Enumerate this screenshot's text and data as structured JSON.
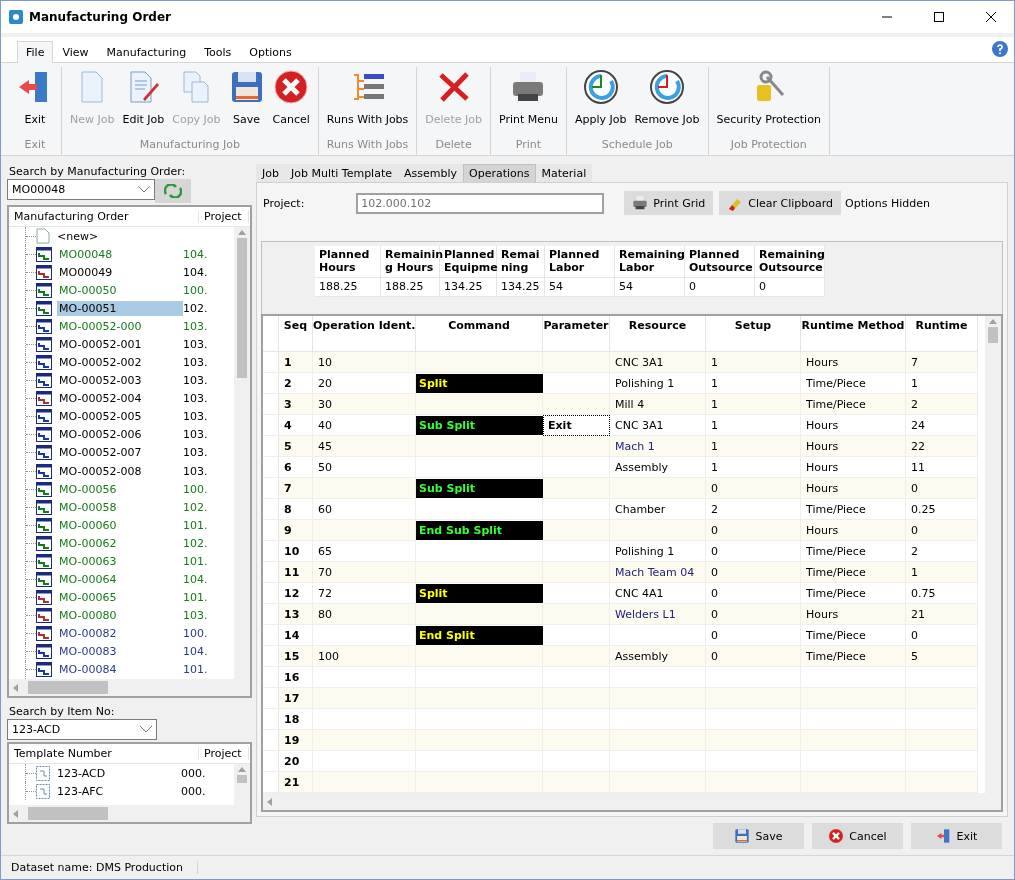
{
  "window": {
    "title": "Manufacturing Order"
  },
  "menu": [
    {
      "label": "File",
      "selected": true
    },
    {
      "label": "View",
      "selected": false
    },
    {
      "label": "Manufacturing",
      "selected": false
    },
    {
      "label": "Tools",
      "selected": false
    },
    {
      "label": "Options",
      "selected": false
    }
  ],
  "ribbon": [
    {
      "label": "Exit",
      "buttons": [
        {
          "label": "Exit",
          "kind": "exit",
          "disabled": false
        }
      ]
    },
    {
      "label": "Manufacturing Job",
      "buttons": [
        {
          "label": "New Job",
          "kind": "new",
          "disabled": true
        },
        {
          "label": "Edit Job",
          "kind": "edit",
          "disabled": false
        },
        {
          "label": "Copy Job",
          "kind": "copy",
          "disabled": true
        },
        {
          "label": "Save",
          "kind": "save",
          "disabled": false
        },
        {
          "label": "Cancel",
          "kind": "cancel",
          "disabled": false
        }
      ]
    },
    {
      "label": "Runs With Jobs",
      "buttons": [
        {
          "label": "Runs With Jobs",
          "kind": "runs",
          "disabled": false
        }
      ]
    },
    {
      "label": "Delete",
      "buttons": [
        {
          "label": "Delete Job",
          "kind": "delete",
          "disabled": true
        }
      ]
    },
    {
      "label": "Print",
      "buttons": [
        {
          "label": "Print Menu",
          "kind": "print",
          "disabled": false
        }
      ]
    },
    {
      "label": "Schedule Job",
      "buttons": [
        {
          "label": "Apply Job",
          "kind": "apply",
          "disabled": false
        },
        {
          "label": "Remove Job",
          "kind": "remove",
          "disabled": false
        }
      ]
    },
    {
      "label": "Job Protection",
      "buttons": [
        {
          "label": "Security Protection",
          "kind": "security",
          "disabled": false
        }
      ]
    }
  ],
  "mo_search": {
    "label": "Search by Manufacturing Order:",
    "value": "MO00048"
  },
  "mo_tree": {
    "columns": [
      "Manufacturing Order",
      "Project"
    ],
    "items": [
      {
        "name": "<new>",
        "kind": "new",
        "color": "#000000",
        "selected": false
      },
      {
        "name": "MO00048",
        "project": "104.",
        "kind": "done",
        "color": "#1a7a1a",
        "selected": false
      },
      {
        "name": "MO00049",
        "project": "104.",
        "kind": "late",
        "color": "#000000",
        "selected": false
      },
      {
        "name": "MO-00050",
        "project": "100.",
        "kind": "done",
        "color": "#1a7a1a",
        "selected": false
      },
      {
        "name": "MO-00051",
        "project": "102.",
        "kind": "done",
        "color": "#000000",
        "selected": true
      },
      {
        "name": "MO-00052-000",
        "project": "103.",
        "kind": "open",
        "color": "#1a7a1a",
        "selected": false
      },
      {
        "name": "MO-00052-001",
        "project": "103.",
        "kind": "open",
        "color": "#000000",
        "selected": false
      },
      {
        "name": "MO-00052-002",
        "project": "103.",
        "kind": "open",
        "color": "#000000",
        "selected": false
      },
      {
        "name": "MO-00052-003",
        "project": "103.",
        "kind": "open",
        "color": "#000000",
        "selected": false
      },
      {
        "name": "MO-00052-004",
        "project": "103.",
        "kind": "late",
        "color": "#000000",
        "selected": false
      },
      {
        "name": "MO-00052-005",
        "project": "103.",
        "kind": "open",
        "color": "#000000",
        "selected": false
      },
      {
        "name": "MO-00052-006",
        "project": "103.",
        "kind": "open",
        "color": "#000000",
        "selected": false
      },
      {
        "name": "MO-00052-007",
        "project": "103.",
        "kind": "open",
        "color": "#000000",
        "selected": false
      },
      {
        "name": "MO-00052-008",
        "project": "103.",
        "kind": "open",
        "color": "#000000",
        "selected": false
      },
      {
        "name": "MO-00056",
        "project": "100.",
        "kind": "done",
        "color": "#1a7a1a",
        "selected": false
      },
      {
        "name": "MO-00058",
        "project": "102.",
        "kind": "done",
        "color": "#1a7a1a",
        "selected": false
      },
      {
        "name": "MO-00060",
        "project": "101.",
        "kind": "done",
        "color": "#1a7a1a",
        "selected": false
      },
      {
        "name": "MO-00062",
        "project": "102.",
        "kind": "done",
        "color": "#1a7a1a",
        "selected": false
      },
      {
        "name": "MO-00063",
        "project": "101.",
        "kind": "done",
        "color": "#1a7a1a",
        "selected": false
      },
      {
        "name": "MO-00064",
        "project": "104.",
        "kind": "done",
        "color": "#1a7a1a",
        "selected": false
      },
      {
        "name": "MO-00065",
        "project": "101.",
        "kind": "late",
        "color": "#1a7a1a",
        "selected": false
      },
      {
        "name": "MO-00080",
        "project": "103.",
        "kind": "late",
        "color": "#1a7a1a",
        "selected": false
      },
      {
        "name": "MO-00082",
        "project": "100.",
        "kind": "late",
        "color": "#2a3a90",
        "selected": false
      },
      {
        "name": "MO-00083",
        "project": "104.",
        "kind": "open",
        "color": "#2a3a90",
        "selected": false
      },
      {
        "name": "MO-00084",
        "project": "101.",
        "kind": "open",
        "color": "#2a3a90",
        "selected": false
      }
    ]
  },
  "item_search": {
    "label": "Search by Item No:",
    "value": "123-ACD"
  },
  "template_tree": {
    "columns": [
      "Template Number",
      "Project"
    ],
    "items": [
      {
        "name": "123-ACD",
        "project": "000."
      },
      {
        "name": "123-AFC",
        "project": "000."
      }
    ]
  },
  "tabs": [
    {
      "label": "Job",
      "selected": false
    },
    {
      "label": "Job Multi Template",
      "selected": false
    },
    {
      "label": "Assembly",
      "selected": false
    },
    {
      "label": "Operations",
      "selected": true
    },
    {
      "label": "Material",
      "selected": false
    }
  ],
  "project": {
    "label": "Project:",
    "value": "102.000.102",
    "disabled": true
  },
  "actions": [
    {
      "label": "Print Grid",
      "kind": "print"
    },
    {
      "label": "Clear Clipboard",
      "kind": "clear"
    }
  ],
  "options_note": "Options Hidden",
  "summary": {
    "columns": [
      "Planned Hours",
      "Remainin g Hours",
      "Planned Equipme",
      "Remai ning",
      "Planned Labor",
      "Remaining Labor",
      "Planned Outsource",
      "Remaining Outsource"
    ],
    "values": [
      "188.25",
      "188.25",
      "134.25",
      "134.25",
      "54",
      "54",
      "0",
      "0"
    ]
  },
  "grid": {
    "columns": [
      "Seq",
      "Operation Ident.",
      "Command",
      "Parameter",
      "Resource",
      "Setup",
      "Runtime Method",
      "Runtime"
    ],
    "rows": [
      {
        "seq": "1",
        "op": "10",
        "resource": "CNC 3A1",
        "resource_linked": false,
        "setup": "1",
        "method": "Hours",
        "runtime": "7"
      },
      {
        "seq": "2",
        "op": "20",
        "command": "Split",
        "nested": false,
        "resource": "Polishing 1",
        "resource_linked": false,
        "setup": "1",
        "method": "Time/Piece",
        "runtime": "1"
      },
      {
        "seq": "3",
        "op": "30",
        "resource": "Mill 4",
        "resource_linked": false,
        "setup": "1",
        "method": "Time/Piece",
        "runtime": "2"
      },
      {
        "seq": "4",
        "op": "40",
        "command": "Sub Split",
        "nested": true,
        "parameter": "Exit",
        "resource": "CNC 3A1",
        "resource_linked": false,
        "setup": "1",
        "method": "Hours",
        "runtime": "24"
      },
      {
        "seq": "5",
        "op": "45",
        "resource": "Mach 1",
        "resource_linked": true,
        "setup": "1",
        "method": "Hours",
        "runtime": "22"
      },
      {
        "seq": "6",
        "op": "50",
        "resource": "Assembly",
        "resource_linked": false,
        "setup": "1",
        "method": "Hours",
        "runtime": "11"
      },
      {
        "seq": "7",
        "command": "Sub Split",
        "nested": true,
        "setup": "0",
        "method": "Hours",
        "runtime": "0"
      },
      {
        "seq": "8",
        "op": "60",
        "resource": "Chamber",
        "resource_linked": false,
        "setup": "2",
        "method": "Time/Piece",
        "runtime": "0.25"
      },
      {
        "seq": "9",
        "command": "End Sub Split",
        "nested": true,
        "setup": "0",
        "method": "Hours",
        "runtime": "0"
      },
      {
        "seq": "10",
        "op": "65",
        "resource": "Polishing 1",
        "resource_linked": false,
        "setup": "0",
        "method": "Time/Piece",
        "runtime": "2"
      },
      {
        "seq": "11",
        "op": "70",
        "resource": "Mach Team 04",
        "resource_linked": true,
        "setup": "0",
        "method": "Time/Piece",
        "runtime": "1"
      },
      {
        "seq": "12",
        "op": "72",
        "command": "Split",
        "nested": false,
        "resource": "CNC 4A1",
        "resource_linked": false,
        "setup": "0",
        "method": "Time/Piece",
        "runtime": "0.75"
      },
      {
        "seq": "13",
        "op": "80",
        "resource": "Welders L1",
        "resource_linked": true,
        "setup": "0",
        "method": "Hours",
        "runtime": "21"
      },
      {
        "seq": "14",
        "command": "End Split",
        "nested": false,
        "setup": "0",
        "method": "Time/Piece",
        "runtime": "0"
      },
      {
        "seq": "15",
        "op": "100",
        "resource": "Assembly",
        "resource_linked": false,
        "setup": "0",
        "method": "Time/Piece",
        "runtime": "5"
      },
      {
        "seq": "16"
      },
      {
        "seq": "17"
      },
      {
        "seq": "18"
      },
      {
        "seq": "19"
      },
      {
        "seq": "20"
      },
      {
        "seq": "21"
      }
    ]
  },
  "footer_buttons": [
    {
      "label": "Save",
      "kind": "save"
    },
    {
      "label": "Cancel",
      "kind": "cancel"
    },
    {
      "label": "Exit",
      "kind": "exit"
    }
  ],
  "status_bar": {
    "label": "Dataset name:",
    "value": "DMS Production"
  }
}
